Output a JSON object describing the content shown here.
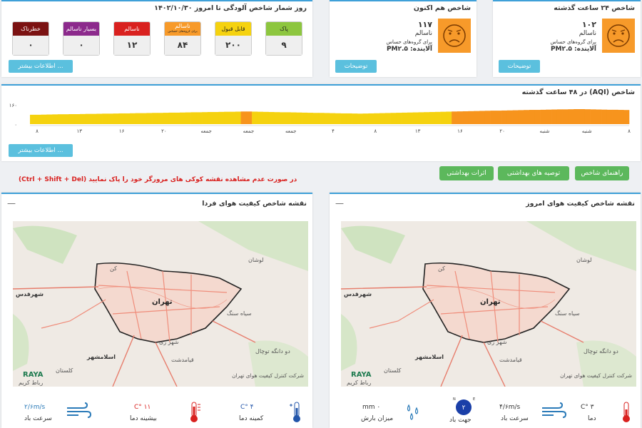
{
  "pollution_days": {
    "title": "روز شمار شاخص آلودگی تا امروز ۱۴۰۲/۱۰/۳۰",
    "categories": [
      {
        "label": "پاک",
        "value": "۹",
        "color": "#8dc63f"
      },
      {
        "label": "قابل قبول",
        "value": "۲۰۰",
        "color": "#f5d20f"
      },
      {
        "label": "ناسالم",
        "sub": "برای گروه‌های حساس",
        "value": "۸۴",
        "color": "#f79a2a"
      },
      {
        "label": "ناسالم",
        "value": "۱۲",
        "color": "#d9211f"
      },
      {
        "label": "بسیار ناسالم",
        "value": "۰",
        "color": "#8c2a8c"
      },
      {
        "label": "خطرناک",
        "value": "۰",
        "color": "#7b1212"
      }
    ],
    "more_button": "اطلاعات بیشتر ..."
  },
  "now_index": {
    "title": "شاخص هم اکنون",
    "value": "۱۱۷",
    "status": "ناسالم",
    "group": "برای گروه‌های حساس",
    "pollutant": "آلاینده: PM۲.۵",
    "explain_button": "توضیحات"
  },
  "index_24h": {
    "title": "شاخص ۲۴ ساعت گذشته",
    "value": "۱۰۲",
    "status": "ناسالم",
    "group": "برای گروه‌های حساس",
    "pollutant": "آلاینده: PM۲.۵",
    "explain_button": "توضیحات"
  },
  "chart48": {
    "title": "شاخص (AQI) در ۴۸ ساعت گذشته",
    "more_button": "اطلاعات بیشتر ..."
  },
  "chart_data": {
    "type": "bar",
    "title": "شاخص (AQI) در ۴۸ ساعت گذشته",
    "ylim": [
      0,
      160
    ],
    "ytick_labels": [
      "۰",
      "۱۶۰"
    ],
    "xtick_labels": [
      "۸",
      "۱۳",
      "۱۶",
      "۲۰",
      "جمعه",
      "جمعه",
      "جمعه",
      "۴",
      "۸",
      "۱۳",
      "۱۶",
      "۲۰",
      "شنبه",
      "شنبه",
      "۸"
    ],
    "grid": false,
    "legend": "none",
    "values": [
      75,
      75,
      76,
      77,
      78,
      79,
      79,
      80,
      80,
      81,
      82,
      82,
      83,
      84,
      84,
      85,
      86,
      86,
      87,
      88,
      88,
      89,
      90,
      90,
      91,
      92,
      92,
      93,
      94,
      95,
      95,
      96,
      97,
      97,
      98,
      99,
      99,
      100,
      101,
      101,
      100,
      99,
      98,
      97,
      96,
      95,
      95,
      94,
      93,
      92,
      91,
      90,
      90,
      89,
      88,
      87,
      86,
      86,
      85,
      84,
      85,
      86,
      87,
      88,
      89,
      90,
      91,
      92,
      93,
      94,
      95,
      96,
      97,
      98,
      99,
      100,
      101,
      102,
      103,
      104,
      105,
      106,
      107,
      108,
      108,
      109,
      110,
      111,
      112,
      113,
      114,
      114,
      115,
      116,
      117,
      118,
      118,
      119,
      120,
      120,
      119,
      118,
      117,
      116,
      115,
      115,
      114,
      113
    ],
    "thresholds": {
      "yellow": "#f5d20f",
      "orange": "#f7941d",
      "split": 100
    }
  },
  "health_buttons": {
    "guide": "راهنمای شاخص",
    "advice": "توصیه های بهداشتی",
    "effects": "اثرات بهداشتی"
  },
  "warning": "در صورت عدم مشاهده نقشه کوکی های مرورگر خود را پاک نمایید (Ctrl + Shift + Del)",
  "map_today": {
    "title": "نقشه شاخص کیفیت هوای امروز",
    "minus": "—",
    "city": "تهران",
    "labels": [
      "شهرقدس",
      "اسلامشهر",
      "شهر ری",
      "قیامدشت",
      "کن",
      "لوشان",
      "سیاه سنگ",
      "دو دانگه توچال",
      "کلستان",
      "رباط کریم"
    ],
    "credit": "شرکت کنترل کیفیت هوای تهران",
    "brand": "RAYA",
    "weather": {
      "temp": "۳ °C",
      "temp_label": "دما",
      "wind": "۴/۶m/s",
      "wind_label": "سرعت باد",
      "direction_label": "جهت باد",
      "direction_value": "۲",
      "rain": "۰ mm",
      "rain_label": "میزان بارش"
    }
  },
  "map_tomorrow": {
    "title": "نقشه شاخص کیفیت هوای فردا",
    "minus": "—",
    "city": "تهران",
    "labels": [
      "شهرقدس",
      "اسلامشهر",
      "شهر ری",
      "قیامدشت",
      "کن",
      "لوشان",
      "سیاه سنگ",
      "دو دانگه توچال",
      "کلستان",
      "رباط کریم"
    ],
    "credit": "شرکت کنترل کیفیت هوای تهران",
    "brand": "RAYA",
    "weather": {
      "min": "۴ °C",
      "min_label": "کمینه دما",
      "max": "۱۱ °C",
      "max_label": "بیشینه دما",
      "wind": "۲/۶m/s",
      "wind_label": "سرعت باد"
    }
  }
}
